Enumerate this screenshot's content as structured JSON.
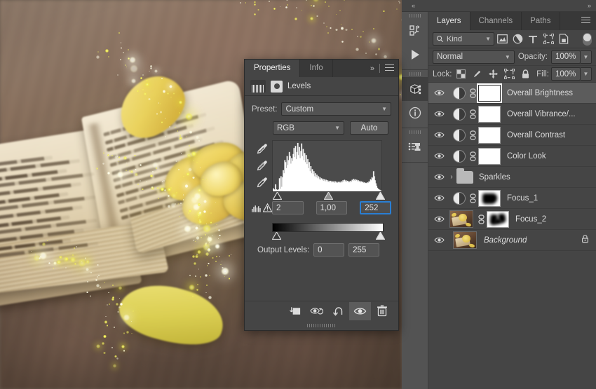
{
  "app": {
    "name": "Adobe Photoshop"
  },
  "canvas": {
    "description": "Photo composite of an open antique German book with yellow tulip blossom and petals, overlaid with golden sparkle bokeh particles"
  },
  "icon_dock": {
    "collapse_left": "«",
    "collapse_right": "»",
    "groups": [
      {
        "items": [
          {
            "name": "adjustments-icon",
            "glyph": "adjustments"
          },
          {
            "name": "actions-play-icon",
            "glyph": "play"
          }
        ]
      },
      {
        "items": [
          {
            "name": "3d-icon",
            "glyph": "3d",
            "active": true
          },
          {
            "name": "info-icon",
            "glyph": "info"
          }
        ]
      },
      {
        "items": [
          {
            "name": "clone-source-icon",
            "glyph": "clone-source"
          }
        ]
      }
    ]
  },
  "properties": {
    "tabs": [
      {
        "label": "Properties",
        "active": true
      },
      {
        "label": "Info",
        "active": false
      }
    ],
    "collapse_glyph": "»",
    "menu_glyph": "≡",
    "adjustment_title": "Levels",
    "preset_label": "Preset:",
    "preset_value": "Custom",
    "channel_value": "RGB",
    "auto_label": "Auto",
    "input_black": "2",
    "input_gamma": "1,00",
    "input_white": "252",
    "output_label": "Output Levels:",
    "output_black": "0",
    "output_white": "255",
    "focused_field": "input_white",
    "footer_buttons": [
      {
        "name": "clip-to-layer-button",
        "glyph": "clip"
      },
      {
        "name": "view-previous-state-button",
        "glyph": "prev-state"
      },
      {
        "name": "reset-button",
        "glyph": "reset"
      },
      {
        "name": "toggle-visibility-button",
        "glyph": "eye",
        "active": true
      },
      {
        "name": "delete-adjustment-button",
        "glyph": "trash"
      }
    ],
    "histogram": [
      6,
      4,
      3,
      14,
      4,
      3,
      3,
      4,
      26,
      5,
      30,
      9,
      28,
      42,
      36,
      62,
      58,
      46,
      70,
      52,
      62,
      78,
      70,
      55,
      66,
      60,
      74,
      86,
      68,
      90,
      64,
      78,
      96,
      72,
      88,
      66,
      80,
      95,
      70,
      84,
      62,
      76,
      58,
      72,
      54,
      64,
      46,
      58,
      40,
      50,
      36,
      44,
      34,
      40,
      30,
      36,
      28,
      33,
      26,
      30,
      24,
      28,
      23,
      26,
      22,
      25,
      21,
      24,
      20,
      23,
      19,
      22,
      19,
      21,
      18,
      21,
      18,
      20,
      18,
      20,
      17,
      20,
      17,
      19,
      17,
      19,
      17,
      19,
      17,
      20,
      18,
      22,
      19,
      23,
      20,
      22,
      19,
      21,
      18,
      20,
      18,
      21,
      19,
      23,
      21,
      25,
      22,
      24,
      21,
      23,
      20,
      22,
      19,
      21,
      18,
      20,
      18,
      19,
      17,
      18,
      16,
      17,
      16,
      18,
      17,
      20,
      19,
      24,
      22,
      28,
      26,
      40,
      30,
      22,
      16,
      11,
      7,
      5,
      4,
      3,
      2,
      2
    ]
  },
  "layers": {
    "tabs": [
      {
        "label": "Layers",
        "active": true
      },
      {
        "label": "Channels",
        "active": false
      },
      {
        "label": "Paths",
        "active": false
      }
    ],
    "menu_glyph": "≡",
    "filter_kind_label": "Kind",
    "filter_icons": [
      {
        "name": "filter-pixel-layers-icon"
      },
      {
        "name": "filter-adjustment-layers-icon"
      },
      {
        "name": "filter-type-layers-icon"
      },
      {
        "name": "filter-shape-layers-icon"
      },
      {
        "name": "filter-smart-object-layers-icon"
      }
    ],
    "blend_mode": "Normal",
    "opacity_label": "Opacity:",
    "opacity_value": "100%",
    "lock_label": "Lock:",
    "lock_icons": [
      {
        "name": "lock-transparent-pixels-icon"
      },
      {
        "name": "lock-image-pixels-icon"
      },
      {
        "name": "lock-position-icon"
      },
      {
        "name": "lock-artboard-nesting-icon"
      },
      {
        "name": "lock-all-icon"
      }
    ],
    "fill_label": "Fill:",
    "fill_value": "100%",
    "items": [
      {
        "name": "Overall Brightness",
        "type": "adjustment",
        "mask": "white",
        "selected": true,
        "visible": true,
        "linked": true
      },
      {
        "name": "Overall Vibrance/...",
        "type": "adjustment",
        "mask": "white",
        "selected": false,
        "visible": true,
        "linked": true
      },
      {
        "name": "Overall Contrast",
        "type": "adjustment",
        "mask": "white",
        "selected": false,
        "visible": true,
        "linked": true
      },
      {
        "name": "Color Look",
        "type": "adjustment",
        "mask": "white",
        "selected": false,
        "visible": true,
        "linked": true
      },
      {
        "name": "Sparkles",
        "type": "group",
        "mask": "none",
        "selected": false,
        "visible": true,
        "linked": false,
        "collapsed": true
      },
      {
        "name": "Focus_1",
        "type": "adjustment",
        "mask": "black-blob",
        "selected": false,
        "visible": true,
        "linked": true
      },
      {
        "name": "Focus_2",
        "type": "pixel",
        "mask": "black-vshape",
        "selected": false,
        "visible": true,
        "linked": true
      },
      {
        "name": "Background",
        "type": "pixel",
        "mask": "none",
        "selected": false,
        "visible": true,
        "linked": false,
        "italic": true,
        "locked": true
      }
    ]
  },
  "colors": {
    "panel_bg": "#454545",
    "panel_tab_bg": "#383838",
    "panel_selected": "#5c5c5c",
    "field_bg": "#535353",
    "text": "#dcdcdc",
    "accent_focus": "#2a7fd4",
    "histogram_fill": "#ffffff",
    "histogram_bg": "#4b4b4b"
  }
}
